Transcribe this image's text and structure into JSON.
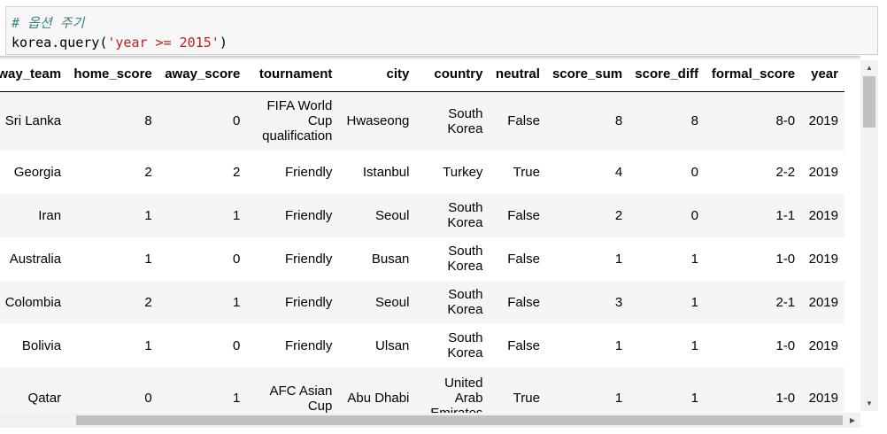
{
  "code_cell": {
    "comment": "# 옵션 주기",
    "code_prefix": "korea.query(",
    "code_string": "'year >= 2015'",
    "code_suffix": ")"
  },
  "table": {
    "columns": [
      "away_team",
      "home_score",
      "away_score",
      "tournament",
      "city",
      "country",
      "neutral",
      "score_sum",
      "score_diff",
      "formal_score",
      "year"
    ],
    "rows": [
      {
        "away_team": "Sri Lanka",
        "home_score": "8",
        "away_score": "0",
        "tournament": "FIFA World Cup qualification",
        "city": "Hwaseong",
        "country": "South Korea",
        "neutral": "False",
        "score_sum": "8",
        "score_diff": "8",
        "formal_score": "8-0",
        "year": "2019"
      },
      {
        "away_team": "Georgia",
        "home_score": "2",
        "away_score": "2",
        "tournament": "Friendly",
        "city": "Istanbul",
        "country": "Turkey",
        "neutral": "True",
        "score_sum": "4",
        "score_diff": "0",
        "formal_score": "2-2",
        "year": "2019"
      },
      {
        "away_team": "Iran",
        "home_score": "1",
        "away_score": "1",
        "tournament": "Friendly",
        "city": "Seoul",
        "country": "South Korea",
        "neutral": "False",
        "score_sum": "2",
        "score_diff": "0",
        "formal_score": "1-1",
        "year": "2019"
      },
      {
        "away_team": "Australia",
        "home_score": "1",
        "away_score": "0",
        "tournament": "Friendly",
        "city": "Busan",
        "country": "South Korea",
        "neutral": "False",
        "score_sum": "1",
        "score_diff": "1",
        "formal_score": "1-0",
        "year": "2019"
      },
      {
        "away_team": "Colombia",
        "home_score": "2",
        "away_score": "1",
        "tournament": "Friendly",
        "city": "Seoul",
        "country": "South Korea",
        "neutral": "False",
        "score_sum": "3",
        "score_diff": "1",
        "formal_score": "2-1",
        "year": "2019"
      },
      {
        "away_team": "Bolivia",
        "home_score": "1",
        "away_score": "0",
        "tournament": "Friendly",
        "city": "Ulsan",
        "country": "South Korea",
        "neutral": "False",
        "score_sum": "1",
        "score_diff": "1",
        "formal_score": "1-0",
        "year": "2019"
      },
      {
        "away_team": "Qatar",
        "home_score": "0",
        "away_score": "1",
        "tournament": "AFC Asian Cup",
        "city": "Abu Dhabi",
        "country": "United Arab Emirates",
        "neutral": "True",
        "score_sum": "1",
        "score_diff": "1",
        "formal_score": "1-0",
        "year": "2019"
      }
    ]
  },
  "icons": {
    "scroll_up": "triangle-up-icon",
    "scroll_down": "triangle-down-icon",
    "scroll_right": "triangle-right-icon"
  }
}
